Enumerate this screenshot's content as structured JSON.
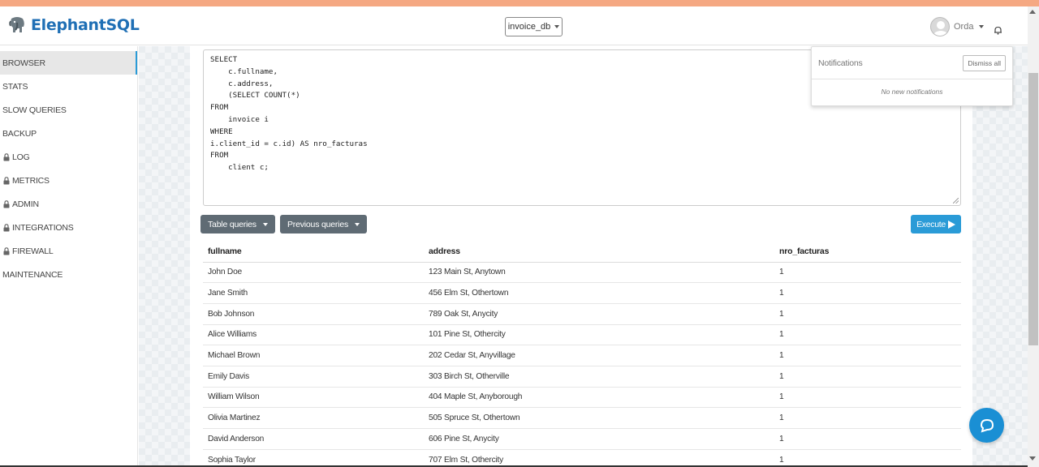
{
  "app": {
    "name": "ElephantSQL"
  },
  "header": {
    "database": "invoice_db",
    "user": "Orda"
  },
  "sidebar": {
    "items": [
      {
        "label": "BROWSER",
        "locked": false,
        "active": true
      },
      {
        "label": "STATS",
        "locked": false,
        "active": false
      },
      {
        "label": "SLOW QUERIES",
        "locked": false,
        "active": false
      },
      {
        "label": "BACKUP",
        "locked": false,
        "active": false
      },
      {
        "label": "LOG",
        "locked": true,
        "active": false
      },
      {
        "label": "METRICS",
        "locked": true,
        "active": false
      },
      {
        "label": "ADMIN",
        "locked": true,
        "active": false
      },
      {
        "label": "INTEGRATIONS",
        "locked": true,
        "active": false
      },
      {
        "label": "FIREWALL",
        "locked": true,
        "active": false
      },
      {
        "label": "MAINTENANCE",
        "locked": false,
        "active": false
      }
    ]
  },
  "editor": {
    "query": "SELECT\n    c.fullname,\n    c.address,\n    (SELECT COUNT(*)\nFROM\n    invoice i\nWHERE\ni.client_id = c.id) AS nro_facturas\nFROM\n    client c;"
  },
  "toolbar": {
    "table_queries": "Table queries",
    "previous_queries": "Previous queries",
    "execute": "Execute"
  },
  "results": {
    "columns": [
      "fullname",
      "address",
      "nro_facturas"
    ],
    "rows": [
      [
        "John Doe",
        "123 Main St, Anytown",
        "1"
      ],
      [
        "Jane Smith",
        "456 Elm St, Othertown",
        "1"
      ],
      [
        "Bob Johnson",
        "789 Oak St, Anycity",
        "1"
      ],
      [
        "Alice Williams",
        "101 Pine St, Othercity",
        "1"
      ],
      [
        "Michael Brown",
        "202 Cedar St, Anyvillage",
        "1"
      ],
      [
        "Emily Davis",
        "303 Birch St, Otherville",
        "1"
      ],
      [
        "William Wilson",
        "404 Maple St, Anyborough",
        "1"
      ],
      [
        "Olivia Martinez",
        "505 Spruce St, Othertown",
        "1"
      ],
      [
        "David Anderson",
        "606 Pine St, Anycity",
        "1"
      ],
      [
        "Sophia Taylor",
        "707 Elm St, Othercity",
        "1"
      ]
    ]
  },
  "notifications": {
    "title": "Notifications",
    "dismiss_all": "Dismiss all",
    "empty": "No new notifications"
  },
  "colors": {
    "brand": "#1f6fb5",
    "accent": "#2a9bd7",
    "top_stripe": "#f5a882",
    "dark_button": "#5f6b74"
  }
}
